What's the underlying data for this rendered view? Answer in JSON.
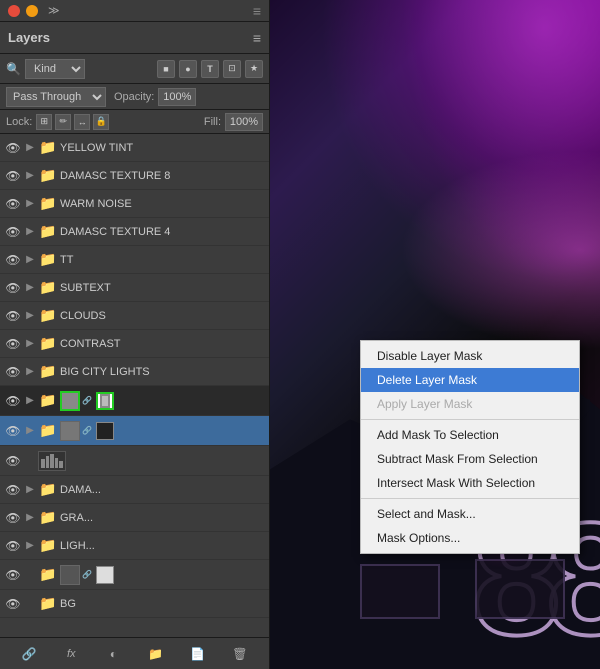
{
  "titleBar": {
    "text": "×"
  },
  "panel": {
    "title": "Layers",
    "menuIcon": "≡",
    "filterRow": {
      "searchIcon": "🔍",
      "kindLabel": "Kind",
      "filterIcons": [
        "■",
        "●",
        "T",
        "⊡",
        "★"
      ]
    },
    "blendRow": {
      "blendMode": "Pass Through",
      "opacityLabel": "Opacity:",
      "opacityValue": "100%"
    },
    "lockRow": {
      "lockLabel": "Lock:",
      "lockIcons": [
        "⊞",
        "✏",
        "↔",
        "🔒"
      ],
      "fillLabel": "Fill:",
      "fillValue": "100%"
    },
    "layers": [
      {
        "name": "YELLOW TINT",
        "type": "folder",
        "visible": true,
        "indent": 0
      },
      {
        "name": "DAMASC TEXTURE 8",
        "type": "folder",
        "visible": true,
        "indent": 0
      },
      {
        "name": "WARM NOISE",
        "type": "folder",
        "visible": true,
        "indent": 0
      },
      {
        "name": "DAMASC TEXTURE 4",
        "type": "folder",
        "visible": true,
        "indent": 0
      },
      {
        "name": "TT",
        "type": "folder",
        "visible": true,
        "indent": 0
      },
      {
        "name": "SUBTEXT",
        "type": "folder",
        "visible": true,
        "indent": 0
      },
      {
        "name": "CLOUDS",
        "type": "folder",
        "visible": true,
        "indent": 0
      },
      {
        "name": "CONTRAST",
        "type": "folder",
        "visible": true,
        "indent": 0
      },
      {
        "name": "BIG CITY LIGHTS",
        "type": "folder",
        "visible": true,
        "indent": 0
      },
      {
        "name": "",
        "type": "masked-active",
        "visible": true,
        "indent": 0
      },
      {
        "name": "",
        "type": "masked-layer",
        "visible": true,
        "indent": 0
      },
      {
        "name": "",
        "type": "graph-layer",
        "visible": true,
        "indent": 0
      },
      {
        "name": "DAMA...",
        "type": "folder",
        "visible": true,
        "indent": 0
      },
      {
        "name": "GRA...",
        "type": "folder",
        "visible": true,
        "indent": 0
      },
      {
        "name": "LIGH...",
        "type": "folder",
        "visible": true,
        "indent": 0
      },
      {
        "name": "",
        "type": "linked-layer",
        "visible": true,
        "indent": 0
      },
      {
        "name": "BG",
        "type": "folder",
        "visible": true,
        "indent": 0
      }
    ],
    "footer": {
      "icons": [
        "🔗",
        "fx",
        "◐",
        "📁",
        "🗑"
      ]
    }
  },
  "contextMenu": {
    "items": [
      {
        "label": "Disable Layer Mask",
        "state": "normal"
      },
      {
        "label": "Delete Layer Mask",
        "state": "selected"
      },
      {
        "label": "Apply Layer Mask",
        "state": "disabled"
      },
      {
        "label": "",
        "state": "separator"
      },
      {
        "label": "Add Mask To Selection",
        "state": "normal"
      },
      {
        "label": "Subtract Mask From Selection",
        "state": "normal"
      },
      {
        "label": "Intersect Mask With Selection",
        "state": "normal"
      },
      {
        "label": "",
        "state": "separator"
      },
      {
        "label": "Select and Mask...",
        "state": "normal"
      },
      {
        "label": "Mask Options...",
        "state": "normal"
      }
    ]
  }
}
